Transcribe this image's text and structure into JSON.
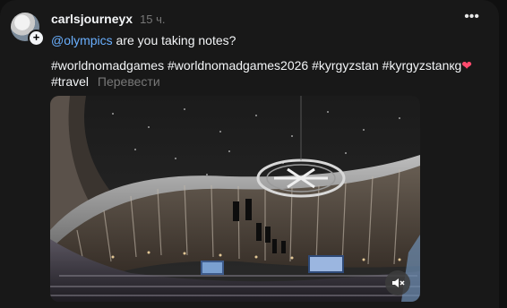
{
  "post": {
    "username": "carlsjourneyx",
    "time": "15 ч.",
    "more_icon": "more-horizontal-icon",
    "mention": "@olympics",
    "text": " are you taking notes?",
    "hashtags": [
      "#worldnomadgames",
      "#worldnomadgames2026",
      "#kyrgyzstan",
      "#kyrgyzstanкg"
    ],
    "heart": "❤",
    "hashtag_line2": "#travel",
    "translate": "Перевести"
  },
  "media": {
    "type": "video",
    "mute_icon": "speaker-muted-icon"
  },
  "colors": {
    "background": "#181818",
    "mention": "#6ab0ff",
    "muted_text": "#777777",
    "heart": "#ff4a6d"
  }
}
